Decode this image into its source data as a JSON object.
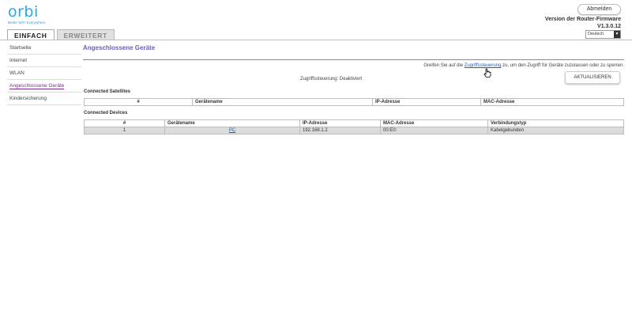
{
  "logo": {
    "text": "orbi",
    "tagline": "Better WiFi Everywhere"
  },
  "tabs": [
    {
      "label": "EINFACH"
    },
    {
      "label": "ERWEITERT"
    }
  ],
  "header": {
    "logout_label": "Abmelden",
    "firmware_label": "Version der Router-Firmware",
    "firmware_version": "V1.3.0.12",
    "language": "Deutsch"
  },
  "sidebar": {
    "items": [
      {
        "label": "Startseite"
      },
      {
        "label": "Internet"
      },
      {
        "label": "WLAN"
      },
      {
        "label": "Angeschlossene Geräte"
      },
      {
        "label": "Kindersicherung"
      }
    ]
  },
  "main": {
    "title": "Angeschlossene Geräte",
    "info_prefix": "Greifen Sie auf die ",
    "info_link": "Zugriffssteuerung",
    "info_suffix": " zu, um den Zugriff für Geräte zuzulassen oder zu sperren.",
    "refresh_label": "AKTUALISIEREN",
    "access_status": "Zugriffssteuerung: Deaktiviert"
  },
  "satellites": {
    "heading": "Connected Satellites",
    "columns": [
      "#",
      "Gerätename",
      "IP-Adresse",
      "MAC-Adresse"
    ]
  },
  "devices": {
    "heading": "Connected Devices",
    "columns": [
      "#",
      "Gerätename",
      "IP-Adresse",
      "MAC-Adresse",
      "Verbindungstyp"
    ],
    "rows": [
      {
        "num": "1",
        "name": "PC",
        "ip": "192.168.1.2",
        "mac": "00:E0:",
        "type": "Kabelgebunden"
      }
    ]
  }
}
